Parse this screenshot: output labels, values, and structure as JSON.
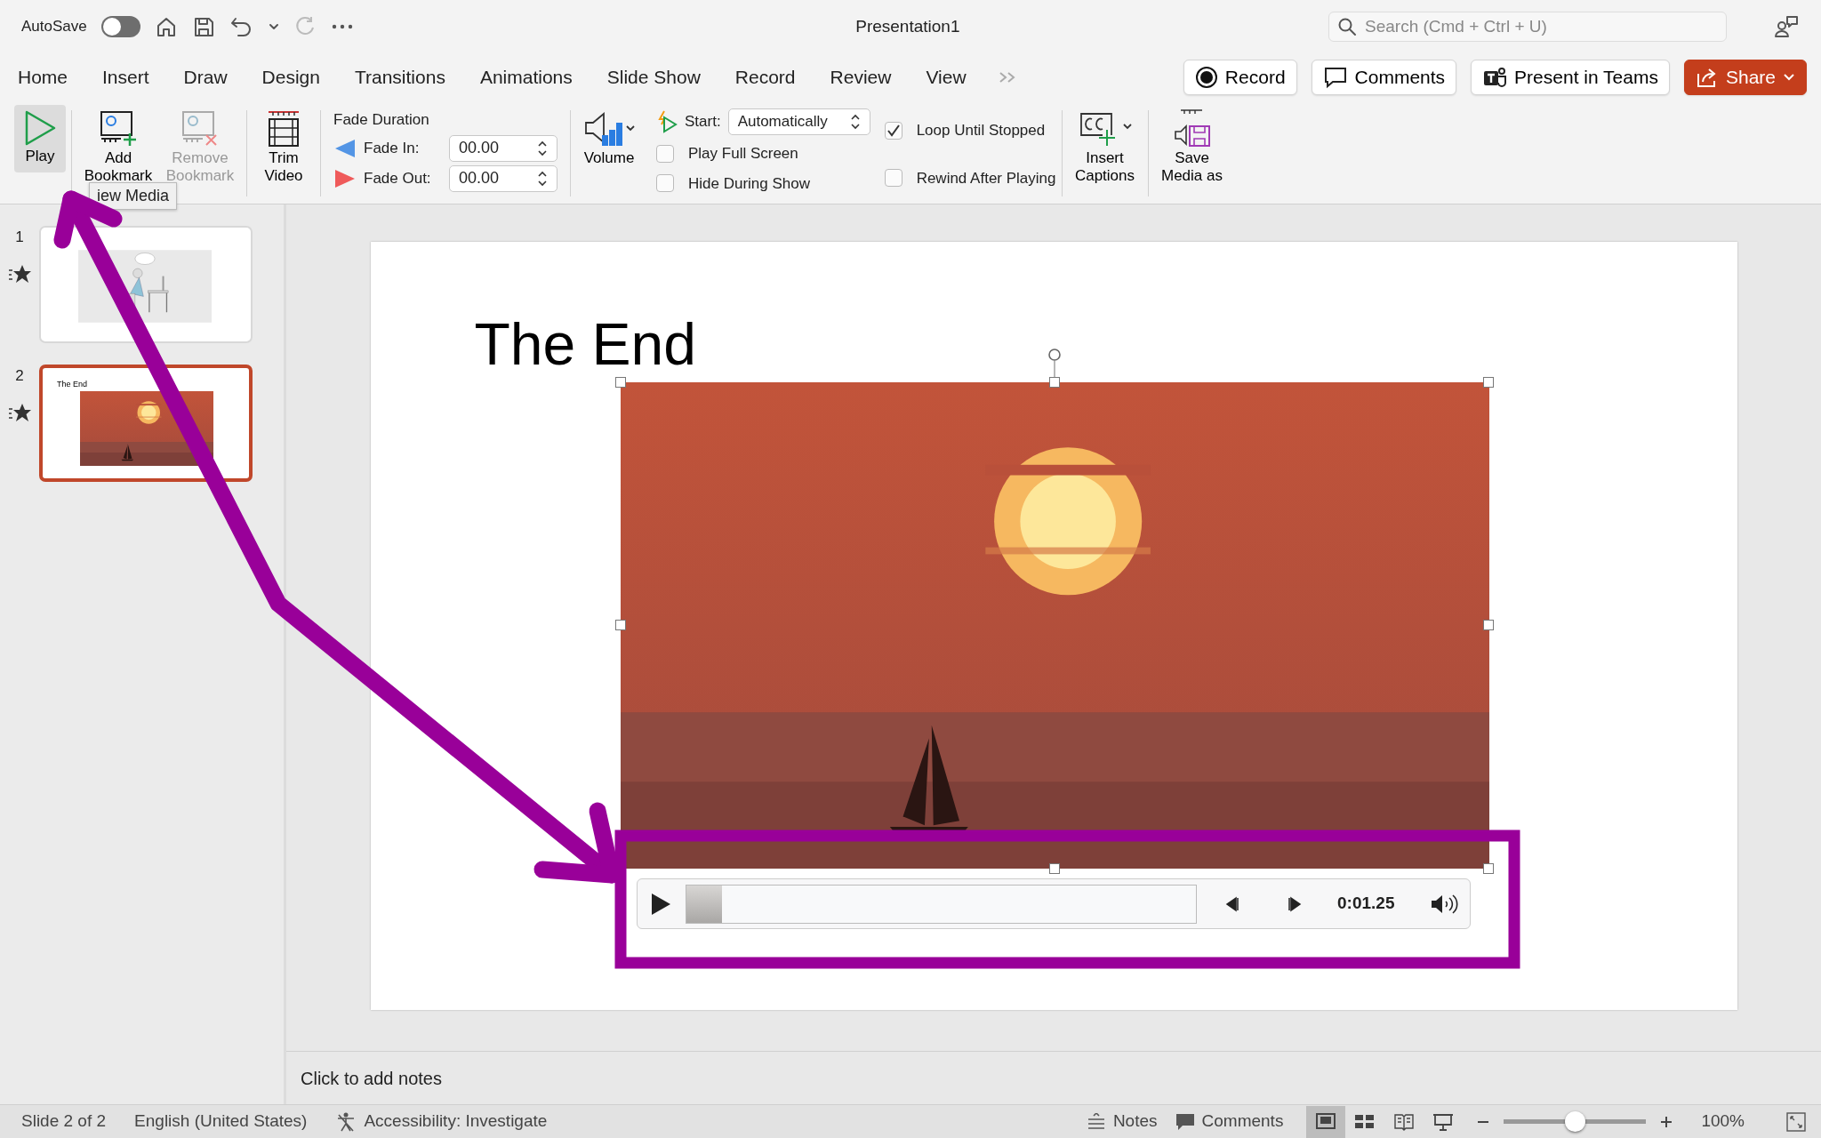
{
  "title_bar": {
    "autosave": {
      "label": "AutoSave",
      "on": false
    },
    "title": "Presentation1",
    "search": {
      "placeholder": "Search (Cmd + Ctrl + U)"
    }
  },
  "tabs": [
    {
      "label": "Home",
      "selected": false
    },
    {
      "label": "Insert",
      "selected": false
    },
    {
      "label": "Draw",
      "selected": false
    },
    {
      "label": "Design",
      "selected": false
    },
    {
      "label": "Transitions",
      "selected": false
    },
    {
      "label": "Animations",
      "selected": false
    },
    {
      "label": "Slide Show",
      "selected": false
    },
    {
      "label": "Record",
      "selected": false
    },
    {
      "label": "Review",
      "selected": false
    },
    {
      "label": "View",
      "selected": false
    }
  ],
  "header_buttons": [
    {
      "label": "Record",
      "kind": "record"
    },
    {
      "label": "Comments",
      "kind": "comments"
    },
    {
      "label": "Present in Teams",
      "kind": "teams"
    },
    {
      "label": "Share",
      "kind": "share"
    }
  ],
  "ribbon": {
    "play": {
      "label": "Play",
      "pressed": true
    },
    "bookmarks": [
      {
        "label": "Add Bookmark",
        "kind": "add",
        "disabled": false
      },
      {
        "label": "Remove Bookmark",
        "kind": "remove",
        "disabled": true
      }
    ],
    "trim": {
      "label": "Trim Video"
    },
    "fade": {
      "title": "Fade Duration",
      "fields": [
        {
          "label": "Fade In:",
          "value": "00.00",
          "kind": "in"
        },
        {
          "label": "Fade Out:",
          "value": "00.00",
          "kind": "out"
        }
      ]
    },
    "volume": {
      "label": "Volume"
    },
    "start": {
      "label": "Start:",
      "value": "Automatically"
    },
    "options": [
      {
        "label": "Play Full Screen",
        "checked": false
      },
      {
        "label": "Hide During Show",
        "checked": false
      },
      {
        "label": "Loop Until Stopped",
        "checked": true
      },
      {
        "label": "Rewind After Playing",
        "checked": false
      }
    ],
    "captions": {
      "label": "Insert Captions"
    },
    "save_media": {
      "label": "Save Media as"
    }
  },
  "tooltip": "iew Media",
  "slides": [
    {
      "number": "1",
      "selected": false,
      "kind": "sketch"
    },
    {
      "number": "2",
      "selected": true,
      "kind": "sunset",
      "title": "The End"
    }
  ],
  "slide": {
    "title": "The End",
    "player": {
      "level": 0.07,
      "time": "0:01.25"
    }
  },
  "notes": {
    "placeholder": "Click to add notes"
  },
  "status_bar": {
    "slide_info": "Slide 2 of 2",
    "language": "English (United States)",
    "accessibility": "Accessibility: Investigate",
    "notes": "Notes",
    "comments": "Comments",
    "views": [
      {
        "kind": "normal",
        "selected": true
      },
      {
        "kind": "sorter",
        "selected": false
      },
      {
        "kind": "reading",
        "selected": false
      },
      {
        "kind": "show",
        "selected": false
      }
    ],
    "zoom": {
      "level": 0.5,
      "reading": "100%"
    }
  }
}
